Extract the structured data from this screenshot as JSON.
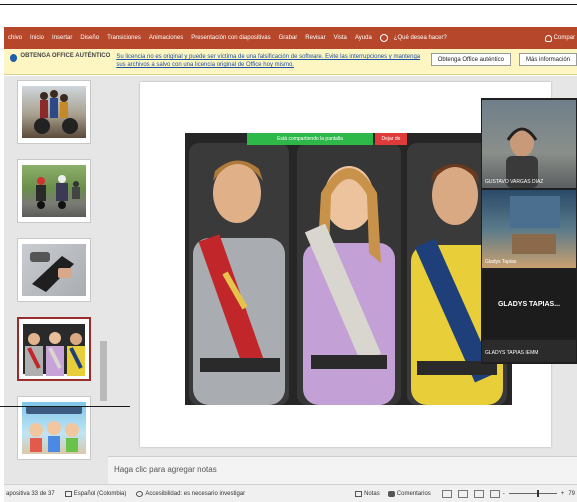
{
  "ribbon": {
    "tabs": [
      "chivo",
      "Inicio",
      "Insertar",
      "Diseño",
      "Transiciones",
      "Animaciones",
      "Presentación con diapositivas",
      "Grabar",
      "Revisar",
      "Vista",
      "Ayuda"
    ],
    "tell_me": "¿Qué desea hacer?",
    "share": "Compar"
  },
  "activation_bar": {
    "title": "OBTENGA OFFICE AUTÉNTICO",
    "message": "Su licencia no es original y puede ser víctima de una falsificación de software. Evite las interrupciones y mantenga sus archivos a salvo con una licencia original de Office hoy mismo.",
    "button_primary": "Obtenga Office auténtico",
    "button_secondary": "Más información"
  },
  "zoom_share": {
    "banner": "Está compartiendo la pantalla",
    "stop": "Dejar de"
  },
  "participants": [
    {
      "name": "GUSTAVO VARGAS DIAZ"
    },
    {
      "name": "Gladys Tapias"
    },
    {
      "name": "GLADYS TAPIAS..."
    },
    {
      "name": "GLADYS TAPIAS IEMM"
    }
  ],
  "notes_placeholder": "Haga clic para agregar notas",
  "status_bar": {
    "slide_count": "apositiva 33 de 37",
    "language": "Español (Colombia)",
    "accessibility": "Accesibilidad: es necesario investigar",
    "notes": "Notas",
    "comments": "Comentarios",
    "zoom": "79"
  },
  "colors": {
    "ribbon": "#b7472a",
    "activation_bg": "#fdf6c3",
    "share_banner": "#2fb84a",
    "stop_share": "#e03b3b",
    "selected_thumb": "#9b2c2c"
  }
}
